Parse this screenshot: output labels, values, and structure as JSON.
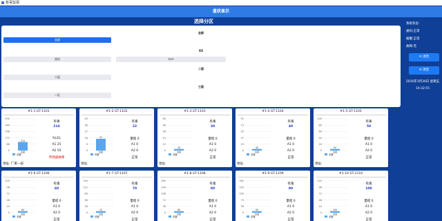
{
  "window": {
    "title": "有毒监视"
  },
  "header": {
    "title": "盘状显示"
  },
  "zones": {
    "title": "选择分区",
    "groups": [
      {
        "label": "全部",
        "items": [
          "全部"
        ]
      },
      {
        "label": "XX",
        "items": [
          "测试",
          "test"
        ]
      },
      {
        "label": "二层",
        "items": [
          "二层"
        ]
      },
      {
        "label": "三层",
        "items": [
          "一区"
        ]
      }
    ]
  },
  "side": {
    "system_status": "系统状态:",
    "comm": "通讯:正常",
    "alarm": "报警:正常",
    "fault": "故障:无",
    "silence_btn": "消音",
    "reset_btn": "消音",
    "date": "2026年3月30日 星期五",
    "time": "10:32:55"
  },
  "cards": [
    {
      "title": "#1-1 GT-1101",
      "gas": "有毒",
      "value": "214",
      "range": "%LEL",
      "a1": "A1 25",
      "a2": "A2 50",
      "status": "传感器故障",
      "fault": true,
      "legend": "浓度",
      "address": "地址: 厂家一层",
      "level": 0.27,
      "ticks": [
        "430",
        "344",
        "258",
        "172",
        "86",
        "0"
      ]
    },
    {
      "title": "#1-2 GT-1102",
      "gas": "有毒",
      "value": "22",
      "range": "量程 0",
      "a1": "A1 0",
      "a2": "A2 0",
      "status": "正常",
      "fault": false,
      "legend": "浓度",
      "address": "地址:",
      "level": 0.37,
      "ticks": [
        "45",
        "36",
        "27",
        "18",
        "9",
        "0"
      ]
    },
    {
      "title": "#1-3 GT-1103",
      "gas": "有毒",
      "value": "30",
      "range": "量程 0",
      "a1": "A1 0",
      "a2": "A2 0",
      "status": "正常",
      "fault": false,
      "legend": "浓度",
      "address": "地址:",
      "level": 0.05,
      "ticks": [
        "60",
        "48",
        "36",
        "24",
        "12",
        "0"
      ]
    },
    {
      "title": "#1-4 GT-1104",
      "gas": "有毒",
      "value": "40",
      "range": "量程 0",
      "a1": "A1 0",
      "a2": "A2 0",
      "status": "正常",
      "fault": false,
      "legend": "浓度",
      "address": "地址:",
      "level": 0.05,
      "ticks": [
        "91",
        "73",
        "55",
        "37",
        "19",
        "0"
      ]
    },
    {
      "title": "#1-5 GT-1105",
      "gas": "有毒",
      "value": "50",
      "range": "量程 0",
      "a1": "A1 0",
      "a2": "A2 0",
      "status": "正常",
      "fault": false,
      "legend": "浓度",
      "address": "地址:",
      "level": 0.05,
      "ticks": [
        "100",
        "80",
        "60",
        "40",
        "20",
        "0"
      ]
    },
    {
      "title": "#1-6 GT-1106",
      "gas": "有毒",
      "value": "60",
      "range": "量程 0",
      "a1": "A1 0",
      "a2": "A2 0",
      "status": "正常",
      "fault": false,
      "legend": "浓度",
      "address": "",
      "level": 0.05,
      "ticks": [
        "120",
        "96",
        "72",
        "48",
        "24",
        "0"
      ]
    },
    {
      "title": "#1-7 GT-1107",
      "gas": "有毒",
      "value": "70",
      "range": "量程 0",
      "a1": "A1 0",
      "a2": "A2 0",
      "status": "正常",
      "fault": false,
      "legend": "浓度",
      "address": "",
      "level": 0.05,
      "ticks": [
        "140",
        "112",
        "84",
        "56",
        "28",
        "0"
      ]
    },
    {
      "title": "#1-8 GT-1108",
      "gas": "有毒",
      "value": "80",
      "range": "量程 0",
      "a1": "A1 0",
      "a2": "A2 0",
      "status": "正常",
      "fault": false,
      "legend": "浓度",
      "address": "",
      "level": 0.05,
      "ticks": [
        "180",
        "144",
        "108",
        "72",
        "36",
        "0"
      ]
    },
    {
      "title": "#1-9 GT-1109",
      "gas": "有毒",
      "value": "90",
      "range": "量程 0",
      "a1": "A1 0",
      "a2": "A2 0",
      "status": "正常",
      "fault": false,
      "legend": "浓度",
      "address": "",
      "level": 0.05,
      "ticks": [
        "182",
        "145",
        "109",
        "73",
        "36",
        "0"
      ]
    },
    {
      "title": "#1-10 GT-1110",
      "gas": "有毒",
      "value": "100",
      "range": "量程 0",
      "a1": "A1 0",
      "a2": "A2 0",
      "status": "正常",
      "fault": false,
      "legend": "浓度",
      "address": "",
      "level": 0.05,
      "ticks": [
        "120",
        "96",
        "72",
        "48",
        "24",
        "0"
      ]
    }
  ],
  "colors": {
    "accent": "#2f7be6",
    "background": "#0f3f96",
    "bar": "#5aa6ec",
    "value": "#1a33c8",
    "fault": "#e01414"
  }
}
